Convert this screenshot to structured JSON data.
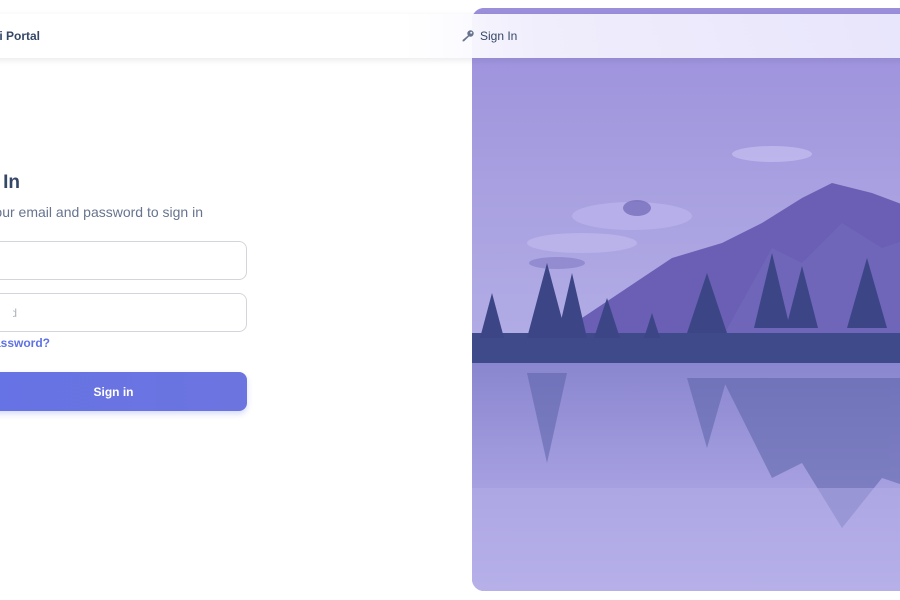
{
  "navbar": {
    "brand": "...ri Portal",
    "signin_link": "Sign In",
    "signin_icon": "key-icon"
  },
  "form": {
    "title": "... In",
    "subtitle": "...your email and password to sign in",
    "email_placeholder": "",
    "password_placeholder": "...word",
    "forgot_link": "...password?",
    "submit_label": "Sign in"
  },
  "colors": {
    "accent": "#5e72e4",
    "text_dark": "#344767",
    "text_muted": "#67748e",
    "image_tint": "#8f86d6"
  }
}
